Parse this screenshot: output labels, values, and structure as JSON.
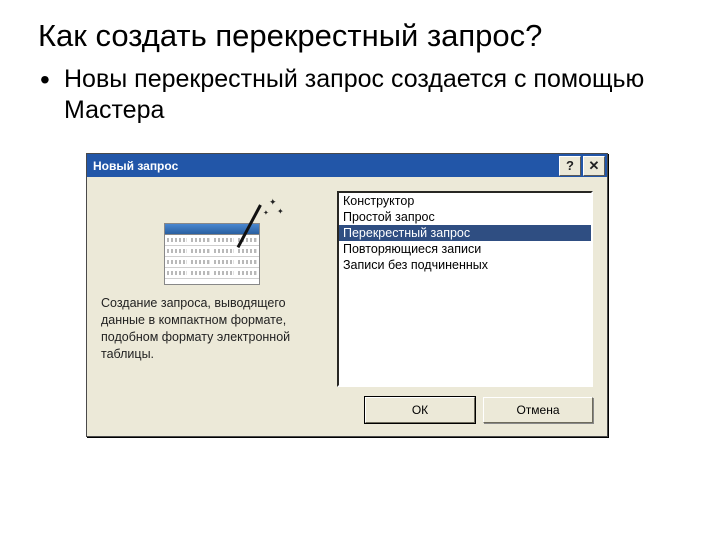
{
  "slide": {
    "title": "Как создать перекрестный запрос?",
    "bullet": "Новы перекрестный запрос создается с помощью Мастера"
  },
  "dialog": {
    "title": "Новый запрос",
    "help_symbol": "?",
    "close_symbol": "✕",
    "description": "Создание запроса, выводящего данные в компактном формате, подобном формату электронной таблицы.",
    "list": {
      "items": [
        "Конструктор",
        "Простой запрос",
        "Перекрестный запрос",
        "Повторяющиеся записи",
        "Записи без подчиненных"
      ],
      "selected_index": 2
    },
    "buttons": {
      "ok": "ОК",
      "cancel": "Отмена"
    }
  }
}
